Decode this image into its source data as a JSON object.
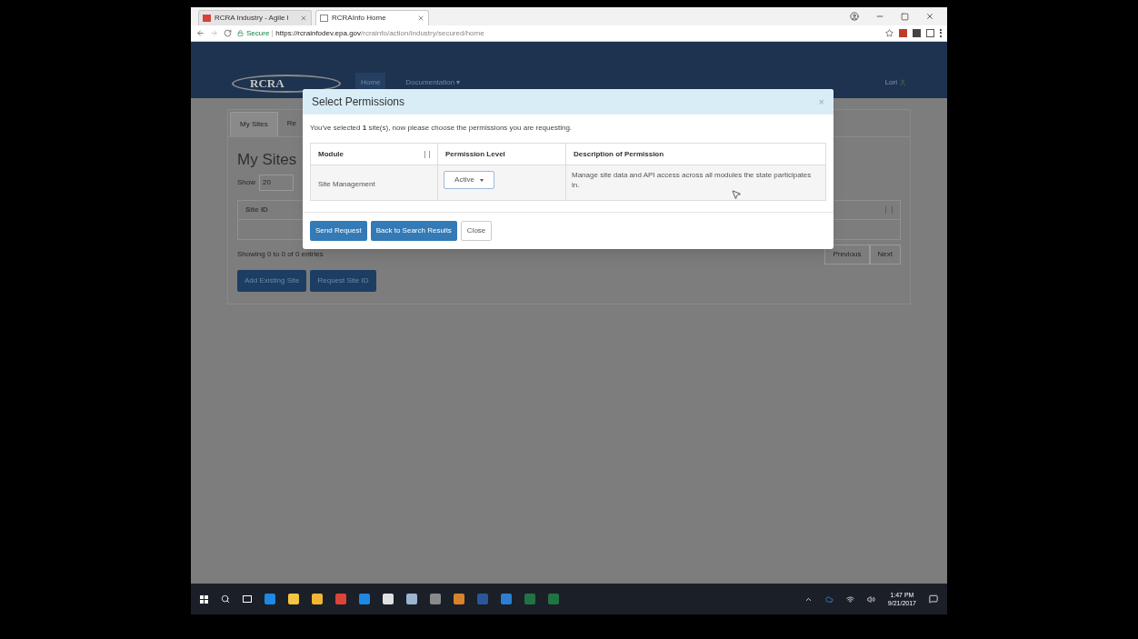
{
  "browser": {
    "tabs": [
      {
        "title": "RCRA Industry - Agile I",
        "selected": false
      },
      {
        "title": "RCRAInfo Home",
        "selected": true
      }
    ],
    "address": {
      "secure_label": "Secure",
      "url_host": "https://rcrainfodev.epa.gov",
      "url_path": "/rcrainfo/action/industry/secured/home"
    }
  },
  "navbar": {
    "logo": "RCRA",
    "items": [
      {
        "label": "Home",
        "selected": true
      },
      {
        "label": "Documentation ▾",
        "selected": false
      }
    ],
    "user": "Lori"
  },
  "page": {
    "tabs": [
      {
        "label": "My Sites",
        "selected": true
      },
      {
        "label": "Re",
        "selected": false
      }
    ],
    "heading": "My Sites",
    "show_label": "Show",
    "show_value": "20",
    "table": {
      "columns": [
        "Site ID"
      ]
    },
    "info": "Showing 0 to 0 of 0 entries",
    "pager": [
      "Previous",
      "Next"
    ],
    "buttons": [
      "Add Existing Site",
      "Request Site ID"
    ]
  },
  "dialog": {
    "title": "Select Permissions",
    "close": "×",
    "message": "You've selected **1** site(s), now please choose the permissions you are requesting.",
    "table": {
      "columns": [
        "Module",
        "Permission Level",
        "Description of Permission"
      ],
      "rows": [
        {
          "module": "Site Management",
          "permission_level": "Active",
          "description": "Manage site data and API access across all modules the state participates in."
        }
      ]
    },
    "buttons": [
      {
        "label": "Send Request",
        "kind": "primary"
      },
      {
        "label": "Back to Search Results",
        "kind": "primary"
      },
      {
        "label": "Close",
        "kind": "default"
      }
    ]
  },
  "taskbar": {
    "time": "1:47 PM",
    "date": "9/21/2017"
  }
}
